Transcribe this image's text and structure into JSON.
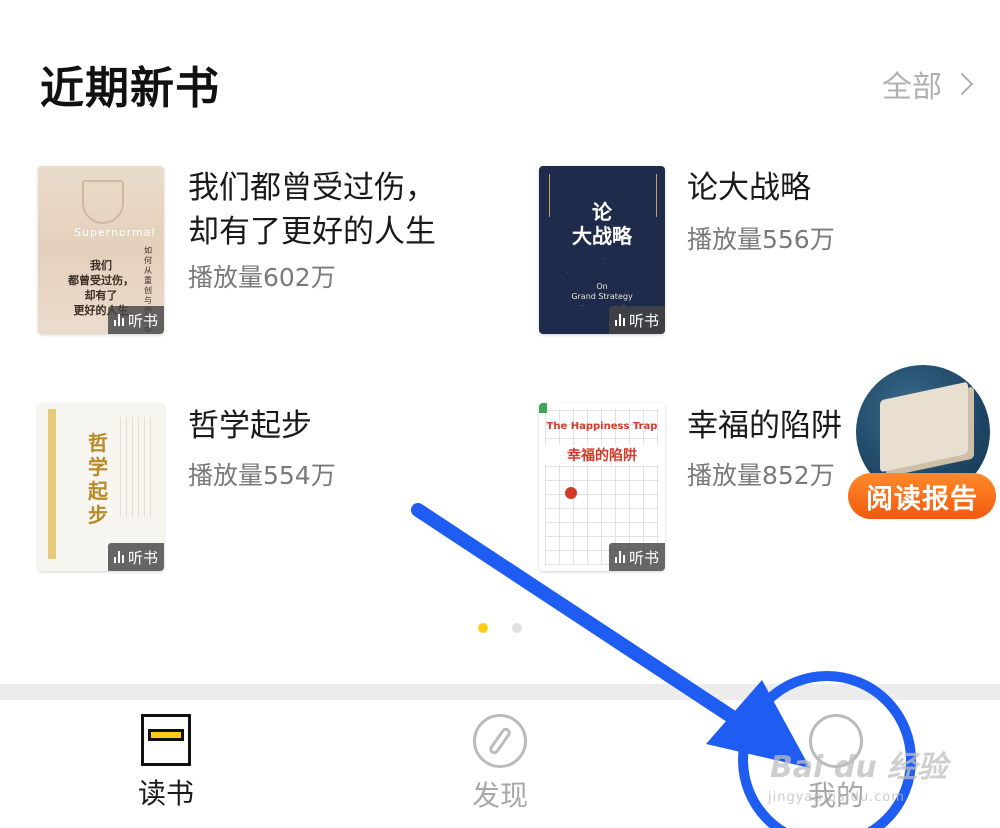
{
  "section": {
    "title": "近期新书",
    "see_all": "全部"
  },
  "books": [
    {
      "title": "我们都曾受过伤，\n却有了更好的人生",
      "plays": "播放量602万",
      "tag": "听书",
      "cover": {
        "en": "Supernormal",
        "cn": "我们\n都曾受过伤，\n却有了\n更好的人生",
        "side": "如何从重创与伤害中复原"
      }
    },
    {
      "title": "论大战略",
      "plays": "播放量556万",
      "tag": "听书",
      "cover": {
        "cn": "论\n大战略",
        "en": "On\nGrand Strategy"
      }
    },
    {
      "title": "哲学起步",
      "plays": "播放量554万",
      "tag": "听书",
      "cover": {
        "cn": "哲学起步"
      }
    },
    {
      "title": "幸福的陷阱",
      "plays": "播放量852万",
      "tag": "听书",
      "cover": {
        "en": "The Happiness Trap",
        "cn": "幸福的陷阱"
      }
    }
  ],
  "pager": {
    "pages": 2,
    "active": 0
  },
  "reading_report": {
    "label": "阅读报告"
  },
  "tabs": [
    {
      "label": "读书",
      "icon": "book-icon",
      "active": true
    },
    {
      "label": "发现",
      "icon": "compass-icon",
      "active": false
    },
    {
      "label": "我的",
      "icon": "user-icon",
      "active": false
    }
  ],
  "watermark": {
    "text": "Bai du 经验",
    "sub": "jingyan.baidu.com"
  },
  "colors": {
    "accent": "#ffcc1a",
    "annotation_arrow": "#1f5cf2",
    "report_badge": "#f26a17"
  }
}
